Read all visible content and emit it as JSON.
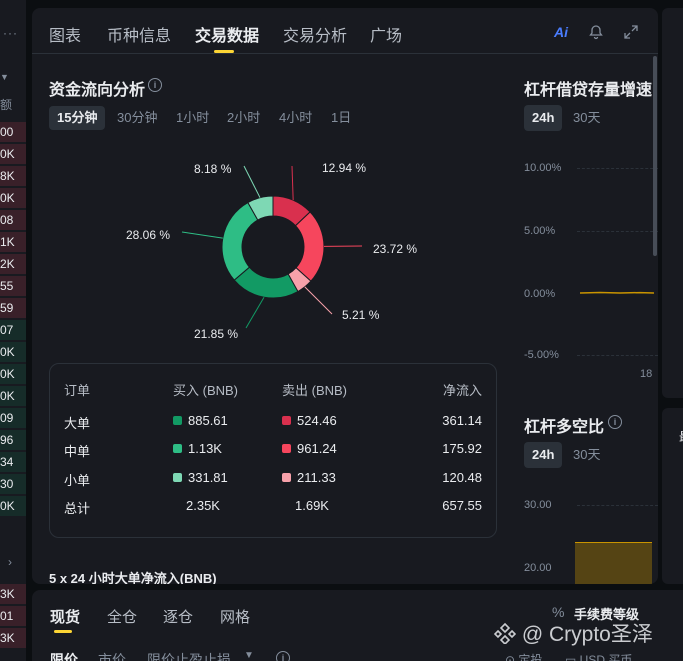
{
  "tabs": [
    "图表",
    "币种信息",
    "交易数据",
    "交易分析",
    "广场"
  ],
  "top_icons": {
    "ai": "Ai"
  },
  "fund_flow": {
    "title": "资金流向分析",
    "intervals": [
      "15分钟",
      "30分钟",
      "1小时",
      "2小时",
      "4小时",
      "1日"
    ],
    "active_interval": "15分钟",
    "donut": [
      {
        "label": "12.94 %",
        "value": 12.94,
        "color": "#d9304e"
      },
      {
        "label": "23.72 %",
        "value": 23.72,
        "color": "#f6465d"
      },
      {
        "label": "5.21 %",
        "value": 5.21,
        "color": "#f7a1aa"
      },
      {
        "label": "21.85 %",
        "value": 21.85,
        "color": "#129a64"
      },
      {
        "label": "28.06 %",
        "value": 28.06,
        "color": "#2ebd85"
      },
      {
        "label": "8.18 %",
        "value": 8.18,
        "color": "#7ed8b4"
      }
    ]
  },
  "order_table": {
    "headers": [
      "订单",
      "买入 (BNB)",
      "卖出 (BNB)",
      "净流入"
    ],
    "rows": [
      {
        "label": "大单",
        "buy": "885.61",
        "sell": "524.46",
        "net": "361.14",
        "buy_color": "#129a64",
        "sell_color": "#d9304e"
      },
      {
        "label": "中单",
        "buy": "1.13K",
        "sell": "961.24",
        "net": "175.92",
        "buy_color": "#2ebd85",
        "sell_color": "#f6465d"
      },
      {
        "label": "小单",
        "buy": "331.81",
        "sell": "211.33",
        "net": "120.48",
        "buy_color": "#7ed8b4",
        "sell_color": "#f7a1aa"
      },
      {
        "label": "总计",
        "buy": "2.35K",
        "sell": "1.69K",
        "net": "657.55"
      }
    ]
  },
  "next_section_title": "5 x 24 小时大单净流入(BNB)",
  "leverage_growth": {
    "title": "杠杆借贷存量增速",
    "buttons": [
      "24h",
      "30天"
    ],
    "y_ticks": [
      "10.00%",
      "5.00%",
      "0.00%",
      "-5.00%"
    ],
    "x_tick": "18"
  },
  "long_short": {
    "title": "杠杆多空比",
    "buttons": [
      "24h",
      "30天"
    ],
    "y_ticks": [
      "30.00",
      "20.00"
    ]
  },
  "left_strip": {
    "header": "额",
    "rows": [
      "00",
      "0K",
      "8K",
      "0K",
      "08",
      "1K",
      "2K",
      "55",
      "59",
      "07",
      "0K",
      "0K",
      "0K",
      "09",
      "96",
      "34",
      "30",
      "0K"
    ],
    "bottom_rows": [
      "3K",
      "01",
      "3K"
    ]
  },
  "bottom": {
    "tabs": [
      "现货",
      "全仓",
      "逐仓",
      "网格"
    ],
    "fee_label": "手续费等级",
    "order_types": [
      "限价",
      "市价",
      "限价止盈止损"
    ],
    "watermark": "@ Crypto圣泽",
    "misc": [
      "定投",
      "USD 买币"
    ]
  }
}
